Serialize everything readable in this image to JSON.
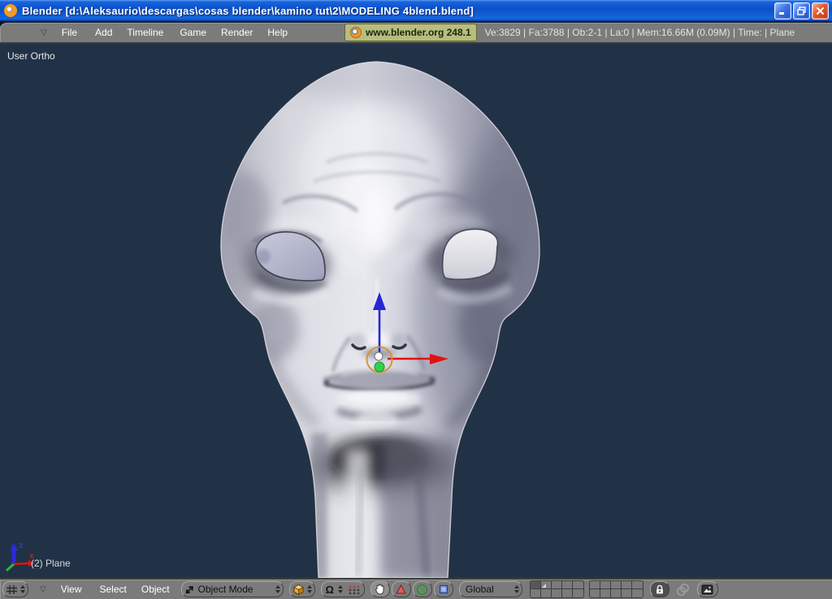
{
  "window": {
    "title": "Blender [d:\\Aleksaurio\\descargas\\cosas blender\\kamino tut\\2\\MODELING 4blend.blend]",
    "controls": {
      "minimize": "minimize",
      "restore": "restore",
      "close": "close"
    }
  },
  "top_header": {
    "menus": [
      "File",
      "Add",
      "Timeline",
      "Game",
      "Render",
      "Help"
    ],
    "badge": "www.blender.org 248.1",
    "stats": "Ve:3829 | Fa:3788 | Ob:2-1 | La:0  | Mem:16.66M (0.09M)  | Time: | Plane"
  },
  "bottom_header": {
    "menus": [
      "View",
      "Select",
      "Object"
    ],
    "mode_dropdown": "Object Mode",
    "orientation_dropdown": "Global"
  },
  "viewport": {
    "view_label": "User Ortho",
    "status_label": "(2) Plane",
    "axis_x_label": "x",
    "axis_z_label": "z"
  },
  "glyphs": {
    "collapse_arrow": "▽",
    "pivot_omega": "Ω"
  },
  "colors": {
    "viewport_bg": "#213247",
    "header_gray": "#7b7b7b",
    "badge_green": "#b6bd7e",
    "manipulator_orange": "#d89030",
    "axis_x_red": "#e01212",
    "axis_y_green": "#2fd24a",
    "axis_z_blue": "#2626d8",
    "titlebar_blue": "#0a50c8"
  }
}
